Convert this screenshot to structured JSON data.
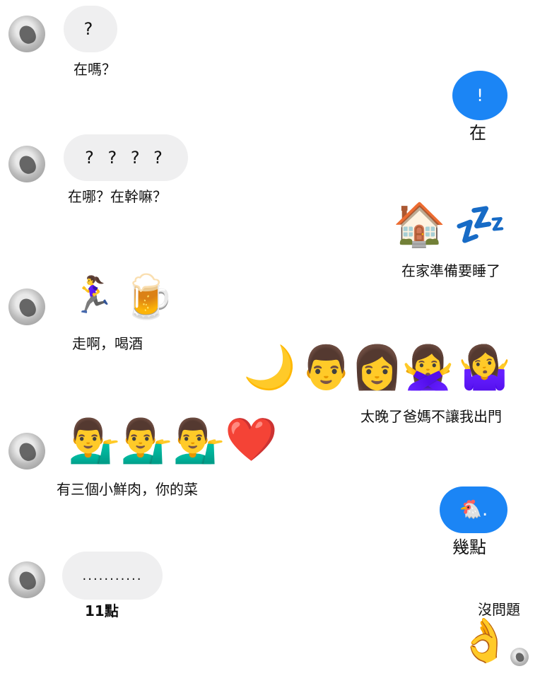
{
  "messages": {
    "m1": {
      "bubble": "?",
      "caption": "在嗎？"
    },
    "m2": {
      "bubble": "!",
      "caption": "在"
    },
    "m3": {
      "bubble": "? ? ? ?",
      "caption": "在哪？在幹嘛？"
    },
    "m4": {
      "emojis": [
        "🏠",
        "💤"
      ],
      "caption": "在家準備要睡了"
    },
    "m5": {
      "emojis": [
        "🏃‍♀️",
        "🍺"
      ],
      "caption": "走啊，喝酒"
    },
    "m6": {
      "emojis": [
        "🌙",
        "👨",
        "👩",
        "🙅‍♀️",
        "🤷‍♀️"
      ],
      "caption": "太晚了爸媽不讓我出門"
    },
    "m7": {
      "emojis": [
        "💁‍♂️",
        "💁‍♂️",
        "💁‍♂️",
        "❤️"
      ],
      "caption": "有三個小鮮肉，你的菜"
    },
    "m8": {
      "bubble": "🐔.",
      "caption": "幾點"
    },
    "m9": {
      "bubble": "...........",
      "caption": "11點"
    },
    "m10": {
      "caption": "沒問題",
      "emoji": "👌"
    }
  }
}
